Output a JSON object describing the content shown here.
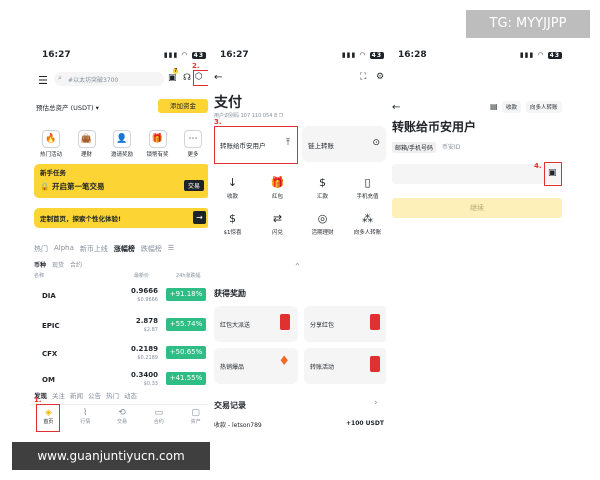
{
  "watermarks": {
    "top": "TG: MYYJJPP",
    "bottom": "www.guanjuntiyucn.com"
  },
  "annotations": [
    "1.",
    "2.",
    "3.",
    "4."
  ],
  "phone1": {
    "status_time": "16:27",
    "battery": "43",
    "search_placeholder": "#以太坊突破3700",
    "badge": "7",
    "asset_label": "预估总资产 (USDT)",
    "add_funds": "添加资金",
    "quick_items": [
      {
        "label": "热门活动",
        "icon": "🔥"
      },
      {
        "label": "理财",
        "icon": "👜"
      },
      {
        "label": "邀请奖励",
        "icon": "👤"
      },
      {
        "label": "锁幣有奖",
        "icon": "🎁"
      },
      {
        "label": "更多",
        "icon": "⋯"
      }
    ],
    "newbie_title": "新手任务",
    "newbie_text": "开启第一笔交易",
    "newbie_btn": "交易",
    "custom_banner": "定制首页，探索个性化体验!",
    "tabs": [
      "热门",
      "Alpha",
      "新币上线",
      "涨幅榜",
      "跌幅榜"
    ],
    "subtabs": [
      "币种",
      "现货",
      "合约"
    ],
    "col_name": "名称",
    "col_price": "最新价",
    "col_change": "24h涨跌幅",
    "rows": [
      {
        "sym": "DIA",
        "price": "0.9666",
        "sub": "$0.9666",
        "change": "+91.18%"
      },
      {
        "sym": "EPIC",
        "price": "2.878",
        "sub": "$2.87",
        "change": "+55.74%"
      },
      {
        "sym": "CFX",
        "price": "0.2189",
        "sub": "$0.2189",
        "change": "+50.65%"
      },
      {
        "sym": "OM",
        "price": "0.3400",
        "sub": "$0.33",
        "change": "+41.55%"
      }
    ],
    "feed_tabs": [
      "发现",
      "关注",
      "新闻",
      "公告",
      "热门",
      "动态"
    ],
    "nav": [
      "首页",
      "行情",
      "交易",
      "合约",
      "资产"
    ]
  },
  "phone2": {
    "status_time": "16:27",
    "battery": "43",
    "title": "支付",
    "subtitle": "用户识别码  107 110 054 8",
    "transfer_btn": "转账给币安用户",
    "chain_btn": "链上转账",
    "grid": [
      {
        "label": "收款",
        "icon": "↓"
      },
      {
        "label": "红包",
        "icon": "🎁"
      },
      {
        "label": "汇款",
        "icon": "$"
      },
      {
        "label": "手机充值",
        "icon": "▯"
      },
      {
        "label": "$1惊喜",
        "icon": "$"
      },
      {
        "label": "闪兑",
        "icon": "⇄"
      },
      {
        "label": "活期理财",
        "icon": "◎"
      },
      {
        "label": "向多人转账",
        "icon": "⁂"
      }
    ],
    "rewards_title": "获得奖励",
    "rewards": [
      "红包大派送",
      "分享红包",
      "热销爆品",
      "转账活动"
    ],
    "records_title": "交易记录",
    "record_text": "收款 - letson789",
    "record_amount": "+100 USDT"
  },
  "phone3": {
    "status_time": "16:28",
    "battery": "43",
    "top_btn1": "收款",
    "top_btn2": "向多人转账",
    "title": "转账给币安用户",
    "tabs": [
      "邮箱/手机号码",
      "币安ID"
    ],
    "continue": "继续"
  }
}
